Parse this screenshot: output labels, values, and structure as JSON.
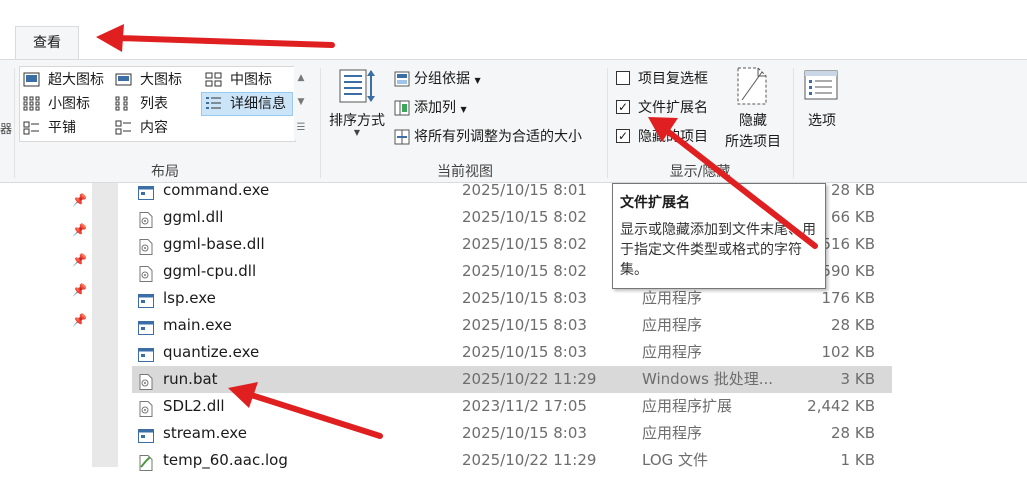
{
  "tabs": {
    "view": "查看"
  },
  "ribbon": {
    "layout": {
      "label": "布局",
      "items": [
        "超大图标",
        "大图标",
        "中图标",
        "小图标",
        "列表",
        "详细信息",
        "平铺",
        "内容"
      ],
      "selected": "详细信息"
    },
    "current_view": {
      "label": "当前视图",
      "sort_by": "排序方式",
      "group_by": "分组依据",
      "add_columns": "添加列",
      "size_all_columns": "将所有列调整为合适的大小"
    },
    "show_hide": {
      "label": "显示/隐藏",
      "item_checkboxes": {
        "label": "项目复选框",
        "checked": false
      },
      "file_name_extensions": {
        "label": "文件扩展名",
        "checked": true
      },
      "hidden_items": {
        "label": "隐藏的项目",
        "checked": true
      },
      "hide_selected_line1": "隐藏",
      "hide_selected_line2": "所选项目"
    },
    "options": {
      "label": "选项"
    }
  },
  "tooltip": {
    "title": "文件扩展名",
    "body": "显示或隐藏添加到文件末尾、用于指定文件类型或格式的字符集。"
  },
  "files": [
    {
      "name": "command.exe",
      "date": "2025/10/15 8:01",
      "type": "",
      "size": "28 KB",
      "icon": "exe-icon",
      "selected": false
    },
    {
      "name": "ggml.dll",
      "date": "2025/10/15 8:02",
      "type": "",
      "size": "66 KB",
      "icon": "dll-icon",
      "selected": false
    },
    {
      "name": "ggml-base.dll",
      "date": "2025/10/15 8:02",
      "type": "",
      "size": "516 KB",
      "icon": "dll-icon",
      "selected": false
    },
    {
      "name": "ggml-cpu.dll",
      "date": "2025/10/15 8:02",
      "type": "",
      "size": "590 KB",
      "icon": "dll-icon",
      "selected": false
    },
    {
      "name": "lsp.exe",
      "date": "2025/10/15 8:03",
      "type": "应用程序",
      "size": "176 KB",
      "icon": "exe-icon",
      "selected": false
    },
    {
      "name": "main.exe",
      "date": "2025/10/15 8:03",
      "type": "应用程序",
      "size": "28 KB",
      "icon": "exe-icon",
      "selected": false
    },
    {
      "name": "quantize.exe",
      "date": "2025/10/15 8:03",
      "type": "应用程序",
      "size": "102 KB",
      "icon": "exe-icon",
      "selected": false
    },
    {
      "name": "run.bat",
      "date": "2025/10/22 11:29",
      "type": "Windows 批处理...",
      "size": "3 KB",
      "icon": "bat-icon",
      "selected": true
    },
    {
      "name": "SDL2.dll",
      "date": "2023/11/2 17:05",
      "type": "应用程序扩展",
      "size": "2,442 KB",
      "icon": "dll-icon",
      "selected": false
    },
    {
      "name": "stream.exe",
      "date": "2025/10/15 8:03",
      "type": "应用程序",
      "size": "28 KB",
      "icon": "exe-icon",
      "selected": false
    },
    {
      "name": "temp_60.aac.log",
      "date": "2025/10/22 11:29",
      "type": "LOG 文件",
      "size": "1 KB",
      "icon": "log-icon",
      "selected": false
    }
  ],
  "colors": {
    "annotation_arrow": "#e02020",
    "selection": "#d9d9d9",
    "ribbon_bg": "#f5f6f7"
  }
}
